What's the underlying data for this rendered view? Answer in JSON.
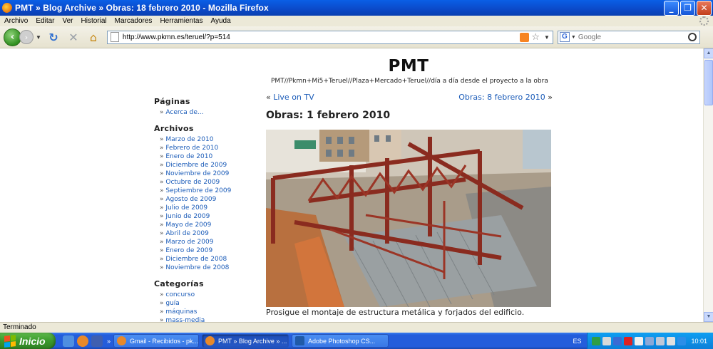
{
  "window": {
    "title": "PMT » Blog Archive » Obras: 18 febrero 2010 - Mozilla Firefox",
    "minimize_glyph": "_",
    "maximize_glyph": "❐",
    "close_glyph": "✕"
  },
  "menu": [
    "Archivo",
    "Editar",
    "Ver",
    "Historial",
    "Marcadores",
    "Herramientas",
    "Ayuda"
  ],
  "nav": {
    "url": "http://www.pkmn.es/teruel/?p=514",
    "search_placeholder": "Google",
    "search_engine_icon": "G"
  },
  "site": {
    "title": "PMT",
    "description": "PMT//Pkmn+Mi5+Teruel//Plaza+Mercado+Teruel//día a día desde el proyecto a la obra"
  },
  "sidebar": {
    "pages_heading": "Páginas",
    "pages": [
      "Acerca de..."
    ],
    "archives_heading": "Archivos",
    "archives": [
      "Marzo de 2010",
      "Febrero de 2010",
      "Enero de 2010",
      "Diciembre de 2009",
      "Noviembre de 2009",
      "Octubre de 2009",
      "Septiembre de 2009",
      "Agosto de 2009",
      "Julio de 2009",
      "Junio de 2009",
      "Mayo de 2009",
      "Abril de 2009",
      "Marzo de 2009",
      "Enero de 2009",
      "Diciembre de 2008",
      "Noviembre de 2008"
    ],
    "categories_heading": "Categorías",
    "categories": [
      "concurso",
      "guía",
      "máquinas",
      "mass-media"
    ]
  },
  "post": {
    "prev_link": "Live on TV",
    "next_link": "Obras: 8 febrero 2010",
    "title": "Obras: 1 febrero 2010",
    "caption": "Prosigue el montaje de estructura metálica y forjados del edificio."
  },
  "status": "Terminado",
  "taskbar": {
    "start_label": "Inicio",
    "tasks": [
      "Gmail - Recibidos - pk...",
      "PMT » Blog Archive » ...",
      "Adobe Photoshop CS..."
    ],
    "language": "ES",
    "clock": "10:01"
  }
}
